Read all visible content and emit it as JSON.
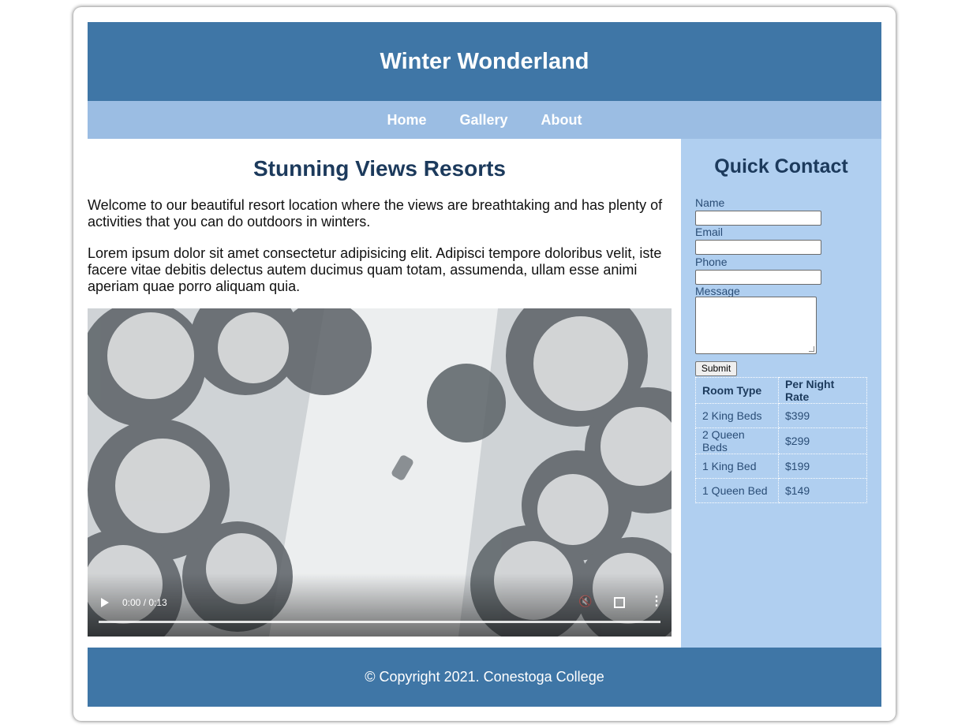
{
  "site": {
    "title": "Winter Wonderland"
  },
  "nav": {
    "items": [
      "Home",
      "Gallery",
      "About"
    ]
  },
  "main": {
    "heading": "Stunning Views Resorts",
    "paragraph1": "Welcome to our beautiful resort location where the views are breathtaking and has plenty of activities that you can do outdoors in winters.",
    "paragraph2": "Lorem ipsum dolor sit amet consectetur adipisicing elit. Adipisci tempore doloribus velit, iste facere vitae debitis delectus autem ducimus quam totam, assumenda, ullam esse animi aperiam quae porro aliquam quia.",
    "video": {
      "time": "0:00 / 0:13",
      "progress": 0
    }
  },
  "contact": {
    "heading": "Quick Contact",
    "labels": {
      "name": "Name",
      "email": "Email",
      "phone": "Phone",
      "message": "Message"
    },
    "submit": "Submit"
  },
  "rates": {
    "headers": [
      "Room Type",
      "Per Night Rate"
    ],
    "rows": [
      [
        "2 King Beds",
        "$399"
      ],
      [
        "2 Queen Beds",
        "$299"
      ],
      [
        "1 King Bed",
        "$199"
      ],
      [
        "1 Queen Bed",
        "$149"
      ]
    ]
  },
  "footer": {
    "text": "© Copyright 2021. Conestoga College"
  },
  "colors": {
    "header": "#3f76a6",
    "nav": "#9bbde3",
    "aside": "#b0cff0",
    "heading": "#1c3a5c"
  }
}
